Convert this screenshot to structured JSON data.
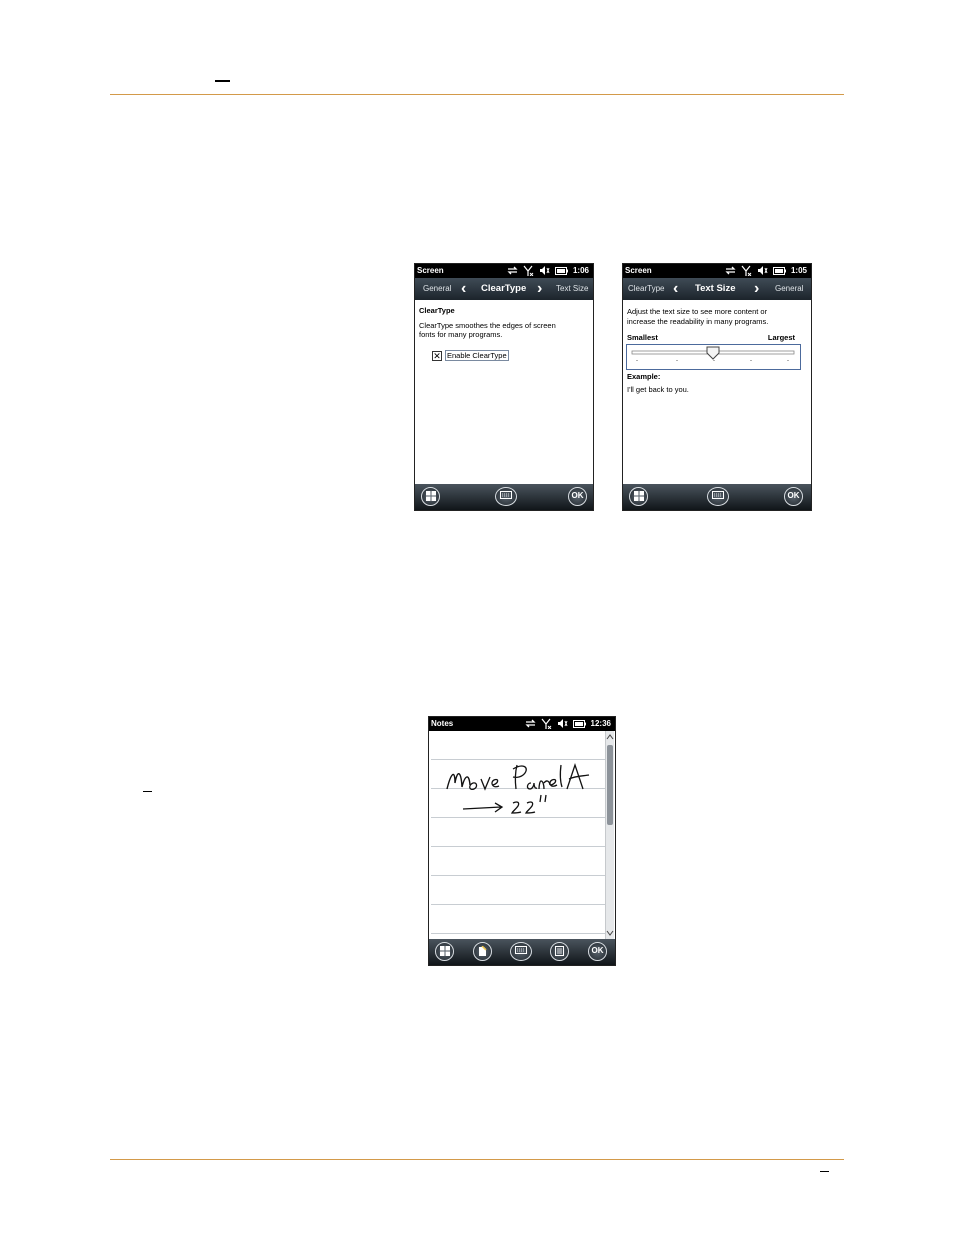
{
  "page": {
    "header_mark": "—",
    "footer_mark": "–",
    "margin_mark": "–"
  },
  "phone_cleartype": {
    "status": {
      "title": "Screen",
      "time": "1:06"
    },
    "tabs": {
      "prev": "General",
      "current": "ClearType",
      "next": "Text Size"
    },
    "heading": "ClearType",
    "description": "ClearType smoothes the edges of screen fonts for many programs.",
    "checkbox": {
      "label": "Enable ClearType",
      "checked": true,
      "mark": "✕"
    },
    "softkeys": {
      "ok": "OK"
    }
  },
  "phone_textsize": {
    "status": {
      "title": "Screen",
      "time": "1:05"
    },
    "tabs": {
      "prev": "ClearType",
      "current": "Text Size",
      "next": "General"
    },
    "description": "Adjust the text size to see more content or increase the readability in many programs.",
    "slider": {
      "min_label": "Smallest",
      "max_label": "Largest",
      "position": 0.5
    },
    "example_heading": "Example:",
    "example_text": "I'll get back to you.",
    "softkeys": {
      "ok": "OK"
    }
  },
  "phone_notes": {
    "status": {
      "title": "Notes",
      "time": "12:36"
    },
    "handwriting": [
      "Move Panel A",
      "→ 22\""
    ],
    "softkeys": {
      "ok": "OK"
    }
  },
  "icons": [
    "windows-start-icon",
    "keyboard-icon",
    "ok-icon",
    "new-note-icon",
    "menu-icon",
    "sync-icon",
    "no-signal-icon",
    "speaker-muted-icon",
    "battery-icon"
  ]
}
